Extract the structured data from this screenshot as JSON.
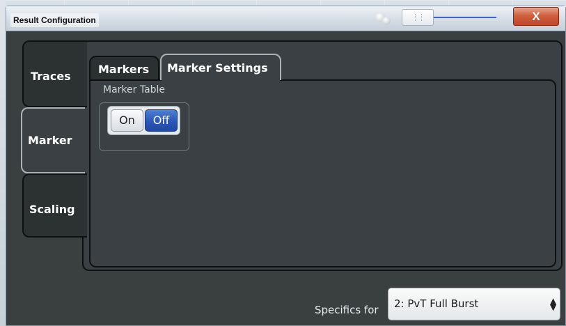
{
  "window": {
    "title": "Result Configuration",
    "close_label": "X"
  },
  "vertical_tabs": [
    {
      "label": "Traces",
      "active": false
    },
    {
      "label": "Marker",
      "active": true
    },
    {
      "label": "Scaling",
      "active": false
    }
  ],
  "horizontal_tabs": [
    {
      "label": "Markers",
      "active": false
    },
    {
      "label": "Marker Settings",
      "active": true
    }
  ],
  "marker_table": {
    "group_label": "Marker Table",
    "on_label": "On",
    "off_label": "Off",
    "selected": "Off"
  },
  "specifics": {
    "label": "Specifics for",
    "value": "2: PvT Full Burst"
  },
  "colors": {
    "accent": "#2a57b8",
    "close_button": "#c2452a",
    "panel": "#3a4043"
  }
}
